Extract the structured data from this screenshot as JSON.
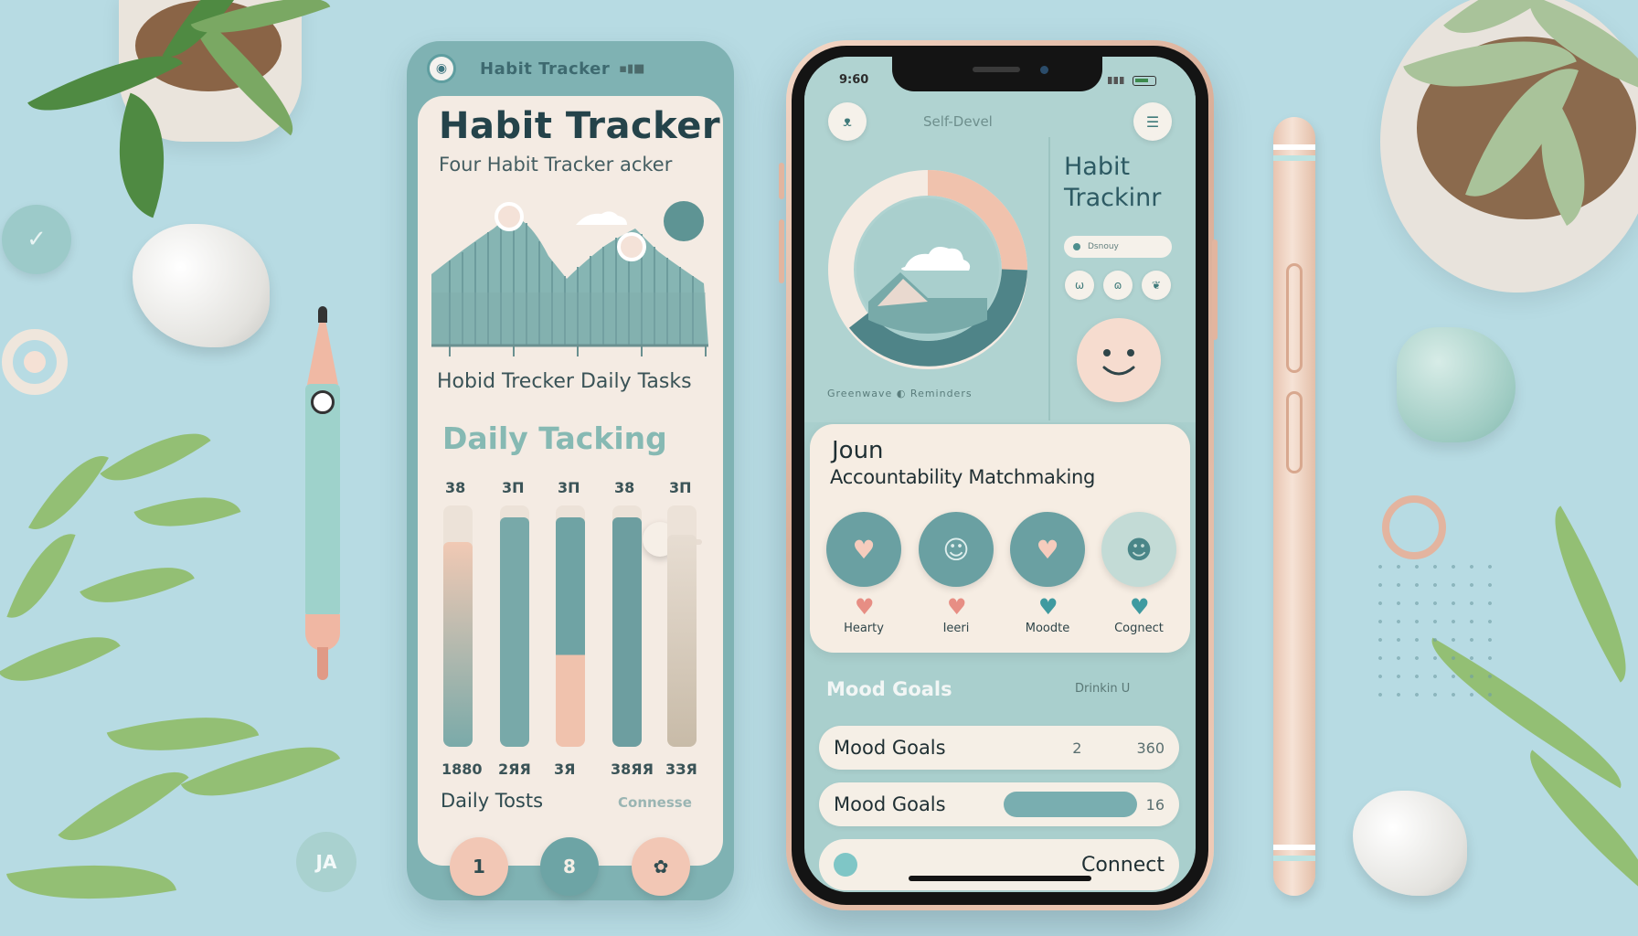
{
  "colors": {
    "background": "#b7dbe3",
    "teal": "#7fb2b3",
    "cream": "#f4ebe3",
    "peach": "#f0c2ad",
    "dark_teal": "#5e8f92"
  },
  "left_app": {
    "header_icon": "logo-icon",
    "header_title": "Habit Tracker",
    "header_status": "▪▮■",
    "title": "Habit Tracker",
    "subtitle": "Four Habit Tracker acker",
    "tasks_label": "Hobid Trecker  Daily Tasks",
    "section_title": "Daily   Tacking",
    "bars": [
      {
        "top": "38",
        "bottom": "1880",
        "fill": 0.85,
        "slider": false
      },
      {
        "top": "3П",
        "bottom": "2ЯЯ",
        "fill": 0.95,
        "slider": false
      },
      {
        "top": "3П",
        "bottom": "3Я",
        "fill": 0.38,
        "slider": false
      },
      {
        "top": "38",
        "bottom": "38ЯЯ",
        "fill": 0.95,
        "slider": false
      },
      {
        "top": "3П",
        "bottom": "3ЗЯ",
        "fill": 0.88,
        "slider": true
      }
    ],
    "footer_label": "Daily Tosts",
    "footer_link": "Connesse",
    "nav": [
      {
        "label": "1",
        "icon": "one-icon"
      },
      {
        "label": "8",
        "icon": "eight-icon"
      },
      {
        "label": "✿",
        "icon": "leaf-icon"
      }
    ]
  },
  "phone": {
    "time": "9:60",
    "header": "Self-Devel",
    "left_icon": "leaf-icon",
    "right_icon": "menu-icon",
    "donut_caption": "Greenwave  ◐  Reminders",
    "habit_title": "Habit Trackinr",
    "habit_pill": "Dsnouy",
    "mini_icons": [
      "leaf-icon",
      "sprout-icon",
      "heart-icon"
    ],
    "smiley_icon": "smiley-icon",
    "journal_title": "Joun",
    "journal_subtitle": "Accountability Matchmaking",
    "moods": [
      {
        "label": "Hearty",
        "btn_icon": "heart-icon",
        "heart": "♥",
        "heart_color": "#e78e84"
      },
      {
        "label": "Ieeri",
        "btn_icon": "smile-icon",
        "heart": "♥",
        "heart_color": "#e78e84"
      },
      {
        "label": "Moodte",
        "btn_icon": "heart-icon",
        "heart": "♥",
        "heart_color": "#3f9aa0"
      },
      {
        "label": "Cognect",
        "btn_icon": "face-icon",
        "heart": "♥",
        "heart_color": "#3f9aa0"
      }
    ],
    "mood_row_label": "Mood Goals",
    "mood_row_right": "Drinkin  U",
    "goals_1": {
      "label": "Mood Goals",
      "mid": "2",
      "right": "360"
    },
    "goals_2": {
      "label": "Mood Goals",
      "right": "16",
      "progress": 0.8
    },
    "connect": {
      "label": "Connect",
      "icon": "toggle-icon"
    }
  }
}
